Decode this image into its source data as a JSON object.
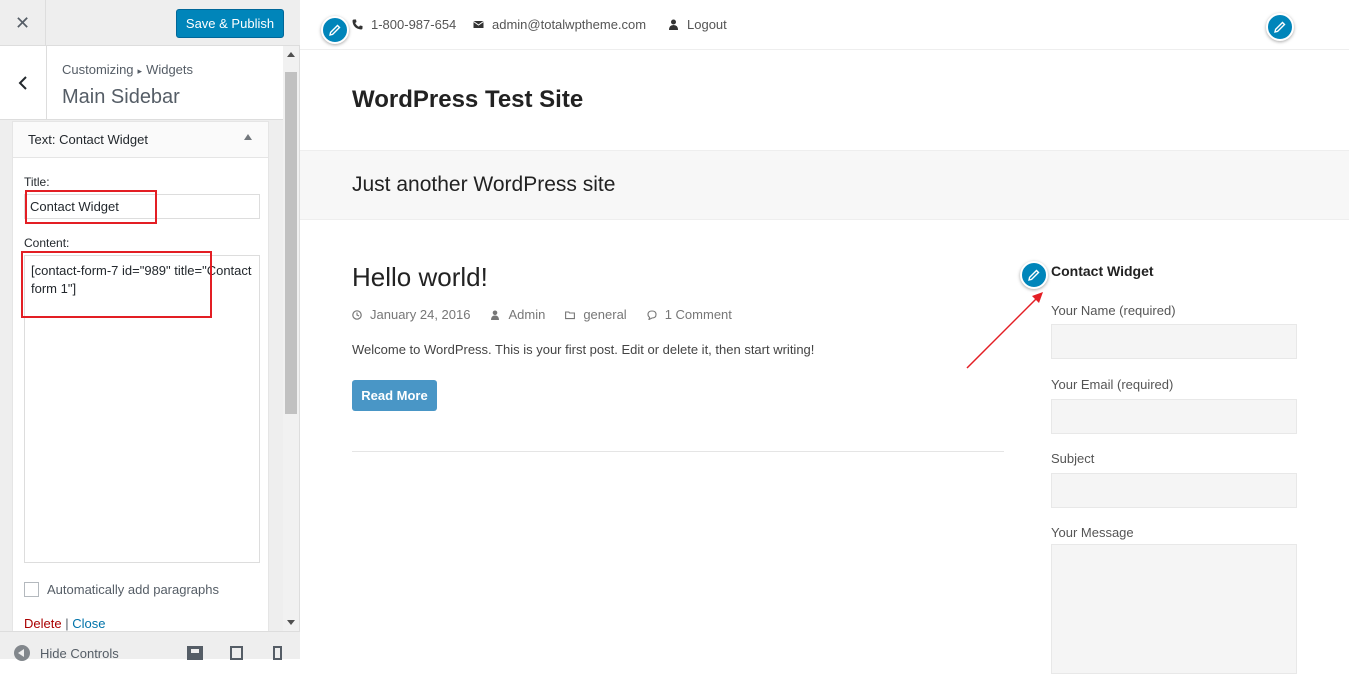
{
  "customizer": {
    "publish_label": "Save & Publish",
    "breadcrumb": {
      "root": "Customizing",
      "separator": "▸",
      "current": "Widgets"
    },
    "section_title": "Main Sidebar",
    "widget": {
      "title_prefix": "Text:",
      "title_name": "Contact Widget",
      "title_label": "Title:",
      "title_value": "Contact Widget",
      "content_label": "Content:",
      "content_value": "[contact-form-7 id=\"989\" title=\"Contact form 1\"]",
      "auto_paragraph_label": "Automatically add paragraphs",
      "delete_label": "Delete",
      "separator": "|",
      "close_label": "Close"
    },
    "footer": {
      "hide_controls_label": "Hide Controls"
    }
  },
  "preview": {
    "topbar": {
      "phone": "1-800-987-654",
      "email": "admin@totalwptheme.com",
      "logout": "Logout"
    },
    "site_title": "WordPress Test Site",
    "tagline": "Just another WordPress site",
    "post": {
      "title": "Hello world!",
      "date": "January 24, 2016",
      "author": "Admin",
      "category": "general",
      "comments": "1 Comment",
      "excerpt": "Welcome to WordPress. This is your first post. Edit or delete it, then start writing!",
      "read_more": "Read More"
    },
    "sidebar_widget": {
      "title": "Contact Widget",
      "fields": [
        "Your Name (required)",
        "Your Email (required)",
        "Subject",
        "Your Message"
      ]
    }
  },
  "colors": {
    "primary_blue": "#0085ba",
    "read_more_blue": "#4996c6",
    "annotation_red": "#e31e24",
    "delete_red": "#aa0000",
    "link_blue": "#0073aa"
  }
}
